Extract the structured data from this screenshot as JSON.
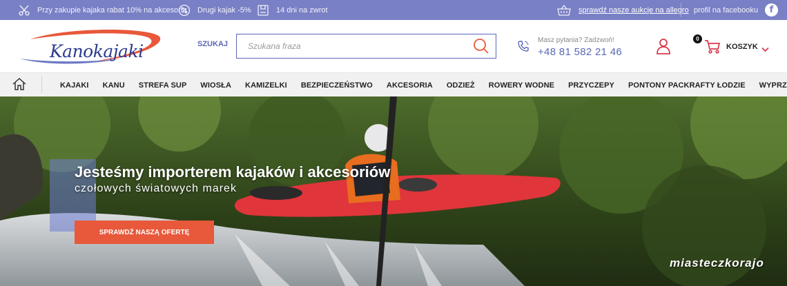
{
  "topbar": {
    "promo_discount": "Przy zakupie kajaka rabat 10% na akcesoria",
    "promo_second": "Drugi kajak -5%",
    "promo_return": "14 dni na zwrot",
    "allegro_link": "sprawdź nasze aukcje na allegro",
    "facebook_label": "profil na facebooku",
    "facebook_glyph": "f"
  },
  "header": {
    "logo_text": "Kanokajaki",
    "search_label": "SZUKAJ",
    "search_placeholder": "Szukana fraza",
    "search_value": "",
    "contact_question": "Masz pytania? Zadzwoń!",
    "phone": "+48 81 582 21 46",
    "cart_count": "0",
    "cart_label": "KOSZYK"
  },
  "nav": {
    "items": [
      {
        "label": "KAJAKI"
      },
      {
        "label": "KANU"
      },
      {
        "label": "STREFA SUP"
      },
      {
        "label": "WIOSŁA"
      },
      {
        "label": "KAMIZELKI"
      },
      {
        "label": "BEZPIECZEŃSTWO"
      },
      {
        "label": "AKCESORIA"
      },
      {
        "label": "ODZIEŻ"
      },
      {
        "label": "ROWERY WODNE"
      },
      {
        "label": "PRZYCZEPY"
      },
      {
        "label": "PONTONY PACKRAFTY ŁODZIE"
      },
      {
        "label": "WYPRZEDAŻE"
      }
    ]
  },
  "hero": {
    "title": "Jesteśmy importerem kajaków i akcesoriów",
    "subtitle": "czołowych światowych marek",
    "cta": "SPRAWDŹ NASZĄ OFERTĘ",
    "watermark": "miasteczkorajo"
  },
  "colors": {
    "brand": "#7a80c5",
    "accent": "#e8583a",
    "link": "#5a67b6",
    "user_icon": "#d9394a"
  },
  "icons": [
    "scissors-icon",
    "percent-icon",
    "return-box-icon",
    "basket-icon",
    "facebook-icon",
    "search-icon",
    "phone-icon",
    "user-icon",
    "cart-icon",
    "chevron-down-icon",
    "home-icon"
  ]
}
